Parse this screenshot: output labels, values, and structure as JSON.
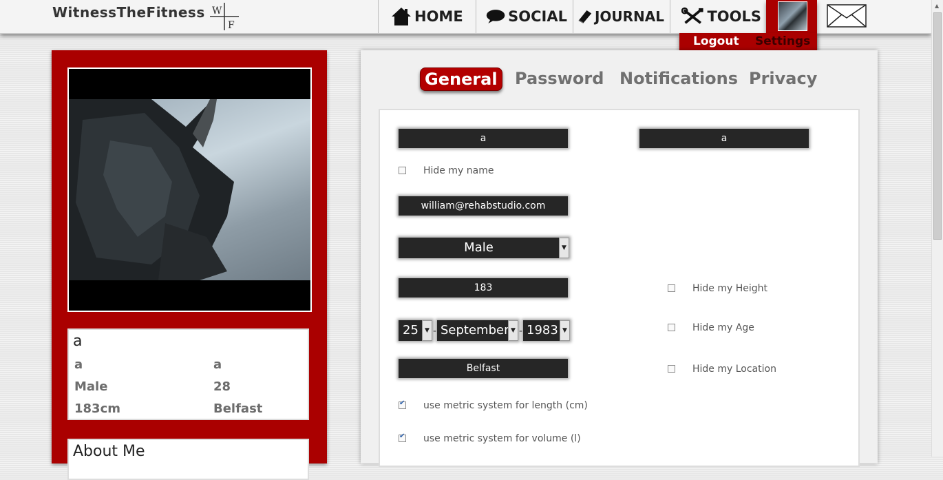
{
  "header": {
    "brand": "WitnessTheFitness",
    "logo_letters": [
      "W",
      "F"
    ],
    "nav": [
      {
        "label": "HOME",
        "icon": "home-icon"
      },
      {
        "label": "SOCIAL",
        "icon": "speech-bubble-icon"
      },
      {
        "label": "JOURNAL",
        "icon": "book-icon"
      },
      {
        "label": "TOOLS",
        "icon": "tools-icon"
      }
    ],
    "user_menu": {
      "logout": "Logout",
      "settings": "Settings"
    },
    "mail_icon": "envelope-icon"
  },
  "profile": {
    "name": "a",
    "first_name": "a",
    "last_name": "a",
    "gender": "Male",
    "age": "28",
    "height": "183cm",
    "location": "Belfast",
    "about_title": "About Me"
  },
  "settings": {
    "tabs": [
      "General",
      "Password",
      "Notifications",
      "Privacy"
    ],
    "active_tab": "General",
    "first_name": "a",
    "last_name": "a",
    "hide_name_label": "Hide my name",
    "email": "william@rehabstudio.com",
    "gender": "Male",
    "height": "183",
    "hide_height_label": "Hide my Height",
    "dob_day": "25",
    "dob_month": "September",
    "dob_year": "1983",
    "hide_age_label": "Hide my Age",
    "location": "Belfast",
    "hide_location_label": "Hide my Location",
    "metric_length_label": "use metric system for length (cm)",
    "metric_volume_label": "use metric system for volume (l)"
  },
  "colors": {
    "accent": "#aa0000",
    "field_bg": "#262626"
  }
}
